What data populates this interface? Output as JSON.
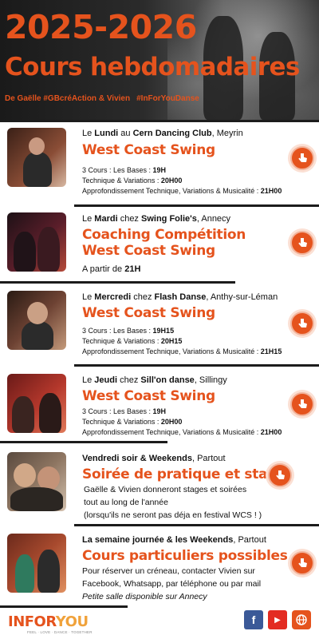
{
  "header": {
    "years": "2025-2026",
    "title": "Cours hebdomadaires",
    "byline": "De Gaëlle #GBcréAction & Vivien",
    "hashtag": "#InForYouDanse"
  },
  "rows": [
    {
      "day_prefix": "Le ",
      "day_bold": "Lundi",
      "venue_prefix": " au ",
      "venue_bold": "Cern Dancing Club",
      "place": ", Meyrin",
      "course": "West Coast Swing",
      "lines": [
        {
          "label": "3 Cours : Les Bases : ",
          "time": "19H"
        },
        {
          "label": "Technique & Variations : ",
          "time": "20H00"
        },
        {
          "label": "Approfondissement Technique, Variations & Musicalité : ",
          "time": "21H00"
        }
      ]
    },
    {
      "day_prefix": "Le ",
      "day_bold": "Mardi",
      "venue_prefix": " chez ",
      "venue_bold": "Swing Folie's",
      "place": ", Annecy",
      "course_line1": "Coaching Compétition",
      "course_line2": "West Coast Swing",
      "from_label": "A partir de ",
      "from_time": "21H"
    },
    {
      "day_prefix": "Le ",
      "day_bold": "Mercredi",
      "venue_prefix": " chez ",
      "venue_bold": "Flash Danse",
      "place": ", Anthy-sur-Léman",
      "course": "West Coast Swing",
      "lines": [
        {
          "label": "3 Cours : Les Bases : ",
          "time": "19H15"
        },
        {
          "label": "Technique & Variations : ",
          "time": "20H15"
        },
        {
          "label": "Approfondissement Technique, Variations & Musicalité : ",
          "time": "21H15"
        }
      ]
    },
    {
      "day_prefix": "Le ",
      "day_bold": "Jeudi",
      "venue_prefix": " chez ",
      "venue_bold": "Sill'on danse",
      "place": ", Sillingy",
      "course": "West Coast Swing",
      "lines": [
        {
          "label": "3 Cours : Les Bases : ",
          "time": "19H"
        },
        {
          "label": "Technique & Variations : ",
          "time": "20H00"
        },
        {
          "label": "Approfondissement Technique, Variations & Musicalité : ",
          "time": "21H00"
        }
      ]
    },
    {
      "day_bold": "Vendredi soir & Weekends",
      "place": ", Partout",
      "course": "Soirée de pratique et stages",
      "text1": "Gaëlle & Vivien donneront stages et soirées",
      "text2": "tout au long de l'année",
      "text3": "(lorsqu'ils ne seront pas déja en festival WCS ! )"
    },
    {
      "day_bold": "La semaine journée & les Weekends",
      "place": ", Partout",
      "course": "Cours particuliers possibles",
      "text1": "Pour réserver un créneau, contacter Vivien sur",
      "text2": "Facebook, Whatsapp, par téléphone ou par mail",
      "text3": "Petite salle disponible sur Annecy"
    }
  ],
  "footer": {
    "logo_part1": "INFOR",
    "logo_part2": "YOU",
    "logo_tagline": "FEEL · LOVE · DANCE · TOGETHER",
    "social": [
      {
        "icon": "facebook-icon",
        "glyph": "f",
        "color": "#3b5998"
      },
      {
        "icon": "youtube-icon",
        "glyph": "▶",
        "color": "#e32b22"
      },
      {
        "icon": "globe-icon",
        "glyph": "🌐",
        "color": "#e5531d"
      }
    ]
  },
  "colors": {
    "accent": "#e5531d",
    "dark": "#1c1c1c"
  }
}
